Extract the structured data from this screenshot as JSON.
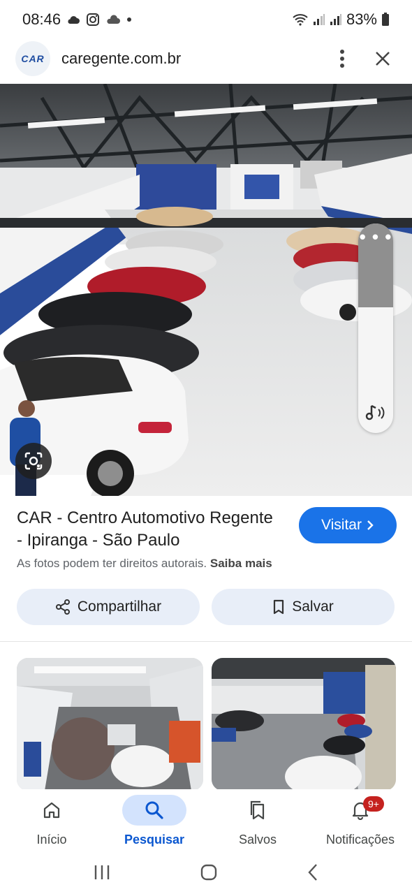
{
  "status_bar": {
    "time": "08:46",
    "battery": "83%",
    "icons": [
      "cloud-icon",
      "instagram-icon",
      "cloud-icon",
      "dot-icon",
      "wifi-icon",
      "signal-icon",
      "signal-icon",
      "battery-icon"
    ]
  },
  "browser": {
    "favicon_text": "CAR",
    "url": "caregente.com.br",
    "icons": [
      "more-vert-icon",
      "close-icon"
    ]
  },
  "result": {
    "title": "CAR - Centro Automotivo Regente - Ipiranga - São Paulo",
    "visit_label": "Visitar",
    "copyright_text": "As fotos podem ter direitos autorais.",
    "learn_more": "Saiba mais"
  },
  "actions": {
    "share_label": "Compartilhar",
    "save_label": "Salvar"
  },
  "bottom_nav": {
    "items": [
      {
        "label": "Início",
        "icon": "home-icon"
      },
      {
        "label": "Pesquisar",
        "icon": "search-icon",
        "active": true
      },
      {
        "label": "Salvos",
        "icon": "bookmarks-icon"
      },
      {
        "label": "Notificações",
        "icon": "bell-icon",
        "badge": "9+"
      }
    ]
  },
  "colors": {
    "accent": "#1a73e8",
    "active_nav": "#0b57d0",
    "badge": "#c5221f"
  }
}
